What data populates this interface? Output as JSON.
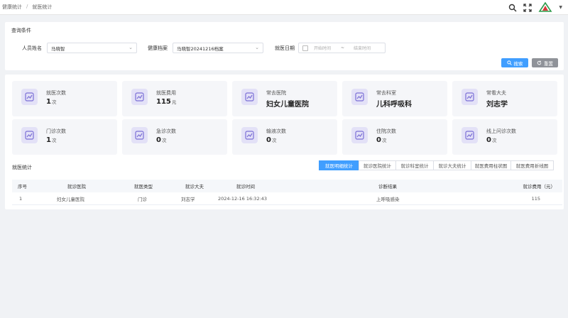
{
  "breadcrumb": [
    "健康统计",
    "就医统计"
  ],
  "query": {
    "title": "查询条件",
    "name_label": "人员姓名",
    "name_value": "马晓智",
    "record_label": "健康档案",
    "record_value": "马晓智20241216档案",
    "date_label": "就医日期",
    "date_start_placeholder": "开始时间",
    "date_sep": "~",
    "date_end_placeholder": "结束时间",
    "search_label": "搜索",
    "reset_label": "重置"
  },
  "cards": [
    {
      "label": "就医次数",
      "value": "1",
      "unit": "次"
    },
    {
      "label": "就医费用",
      "value": "115",
      "unit": "元"
    },
    {
      "label": "常去医院",
      "value": "妇女儿童医院",
      "unit": ""
    },
    {
      "label": "常去科室",
      "value": "儿科呼吸科",
      "unit": ""
    },
    {
      "label": "常看大夫",
      "value": "刘志学",
      "unit": ""
    },
    {
      "label": "门诊次数",
      "value": "1",
      "unit": "次"
    },
    {
      "label": "急诊次数",
      "value": "0",
      "unit": "次"
    },
    {
      "label": "输液次数",
      "value": "0",
      "unit": "次"
    },
    {
      "label": "住院次数",
      "value": "0",
      "unit": "次"
    },
    {
      "label": "线上问诊次数",
      "value": "0",
      "unit": "次"
    }
  ],
  "section_title": "就医统计",
  "tabs": [
    "就医明细统计",
    "就诊医院统计",
    "就诊科室统计",
    "就诊大夫统计",
    "就医费用柱状图",
    "就医费用折线图"
  ],
  "table": {
    "headers": [
      "序号",
      "就诊医院",
      "就医类型",
      "就诊大夫",
      "就诊时间",
      "诊断结果",
      "就诊费用（元）"
    ],
    "rows": [
      [
        "1",
        "妇女儿童医院",
        "门诊",
        "刘志学",
        "2024-12-16 16:32:43",
        "上呼吸感染",
        "115"
      ]
    ]
  },
  "colors": {
    "primary": "#409eff",
    "reset": "#909399",
    "card_icon_bg": "#e3e1f7",
    "card_icon": "#7b6fd6"
  }
}
